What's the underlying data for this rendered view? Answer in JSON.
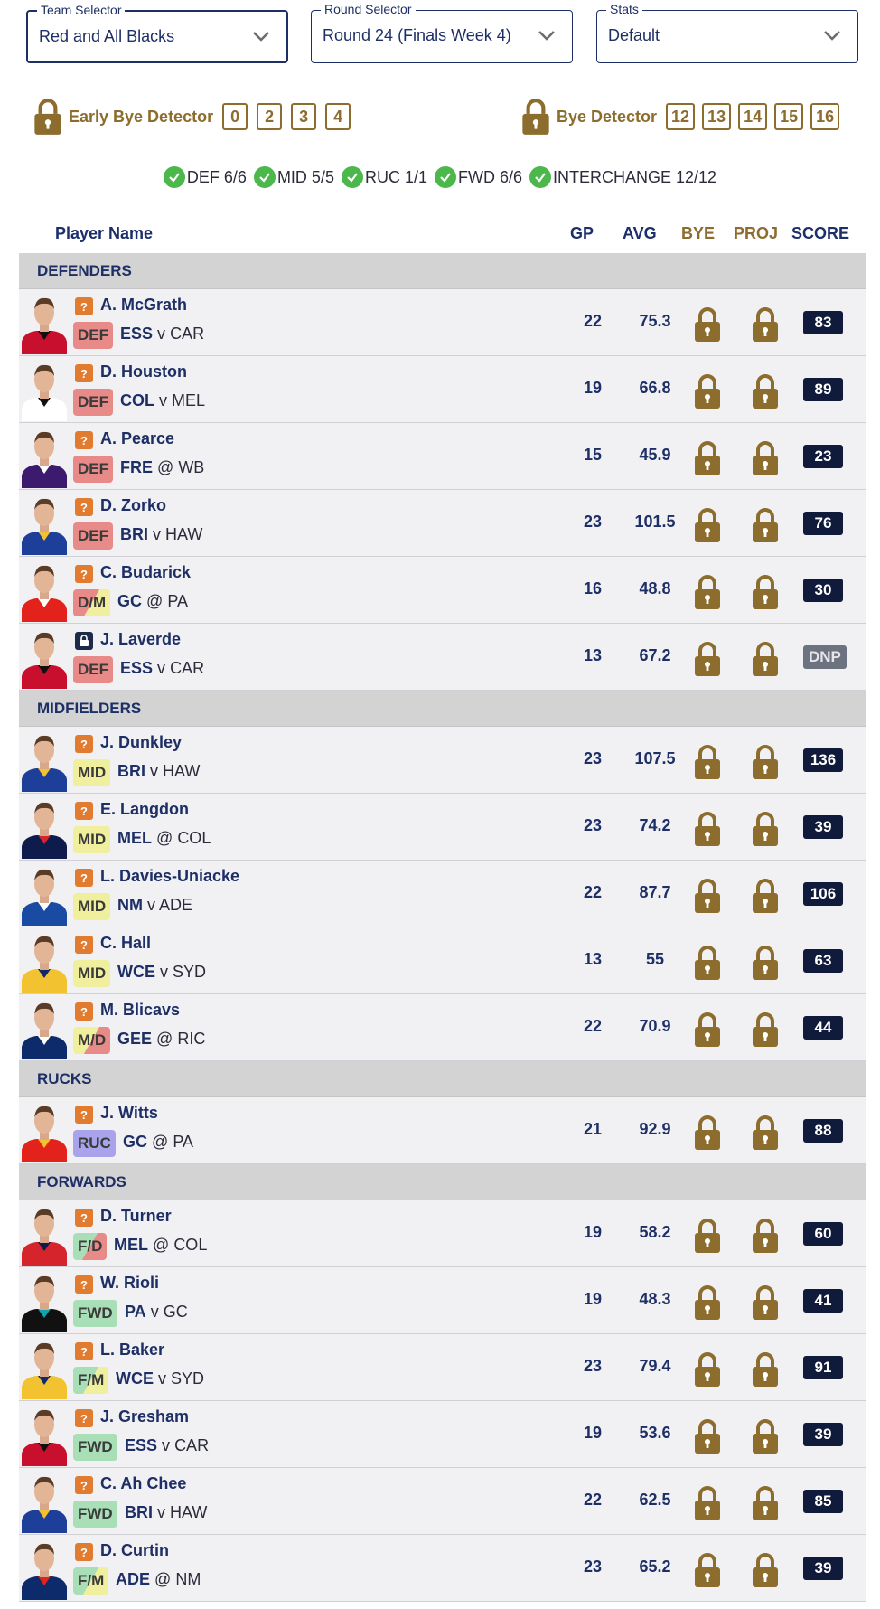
{
  "selectors": {
    "team": {
      "label": "Team Selector",
      "value": "Red and All Blacks"
    },
    "round": {
      "label": "Round Selector",
      "value": "Round 24 (Finals Week 4)"
    },
    "stats": {
      "label": "Stats",
      "value": "Default"
    }
  },
  "early_bye": {
    "label": "Early Bye Detector",
    "boxes": [
      "0",
      "2",
      "3",
      "4"
    ]
  },
  "bye": {
    "label": "Bye Detector",
    "boxes": [
      "12",
      "13",
      "14",
      "15",
      "16"
    ]
  },
  "summary": [
    "DEF 6/6",
    "MID 5/5",
    "RUC 1/1",
    "FWD 6/6",
    "INTERCHANGE 12/12"
  ],
  "table_header": {
    "name": "Player Name",
    "gp": "GP",
    "avg": "AVG",
    "bye": "BYE",
    "proj": "PROJ",
    "score": "SCORE"
  },
  "colors": {
    "navy": "#1e2f66",
    "gold": "#8c6d2e",
    "check": "#4cb74a",
    "score_bg": "#101a3a"
  },
  "sections": [
    {
      "title": "DEFENDERS",
      "players": [
        {
          "name": "A. McGrath",
          "pos": "DEF",
          "team": "ESS",
          "sep": "v",
          "opp": "CAR",
          "gp": "22",
          "avg": "75.3",
          "score": "83",
          "status": "?",
          "jersey": [
            "#c8102e",
            "#101010"
          ]
        },
        {
          "name": "D. Houston",
          "pos": "DEF",
          "team": "COL",
          "sep": "v",
          "opp": "MEL",
          "gp": "19",
          "avg": "66.8",
          "score": "89",
          "status": "?",
          "jersey": [
            "#ffffff",
            "#111111"
          ]
        },
        {
          "name": "A. Pearce",
          "pos": "DEF",
          "team": "FRE",
          "sep": "@",
          "opp": "WB",
          "gp": "15",
          "avg": "45.9",
          "score": "23",
          "status": "?",
          "jersey": [
            "#3c1a6e",
            "#ffffff"
          ]
        },
        {
          "name": "D. Zorko",
          "pos": "DEF",
          "team": "BRI",
          "sep": "v",
          "opp": "HAW",
          "gp": "23",
          "avg": "101.5",
          "score": "76",
          "status": "?",
          "jersey": [
            "#1e3f99",
            "#f2c230"
          ]
        },
        {
          "name": "C. Budarick",
          "pos": "D/M",
          "team": "GC",
          "sep": "@",
          "opp": "PA",
          "gp": "16",
          "avg": "48.8",
          "score": "30",
          "status": "?",
          "jersey": [
            "#e3231b",
            "#ffffff"
          ]
        },
        {
          "name": "J. Laverde",
          "pos": "DEF",
          "team": "ESS",
          "sep": "v",
          "opp": "CAR",
          "gp": "13",
          "avg": "67.2",
          "score": "DNP",
          "status": "lock",
          "jersey": [
            "#c8102e",
            "#101010"
          ]
        }
      ]
    },
    {
      "title": "MIDFIELDERS",
      "players": [
        {
          "name": "J. Dunkley",
          "pos": "MID",
          "team": "BRI",
          "sep": "v",
          "opp": "HAW",
          "gp": "23",
          "avg": "107.5",
          "score": "136",
          "status": "?",
          "jersey": [
            "#1e3f99",
            "#f2c230"
          ]
        },
        {
          "name": "E. Langdon",
          "pos": "MID",
          "team": "MEL",
          "sep": "@",
          "opp": "COL",
          "gp": "23",
          "avg": "74.2",
          "score": "39",
          "status": "?",
          "jersey": [
            "#0e1b4d",
            "#d5242c"
          ]
        },
        {
          "name": "L. Davies-Uniacke",
          "pos": "MID",
          "team": "NM",
          "sep": "v",
          "opp": "ADE",
          "gp": "22",
          "avg": "87.7",
          "score": "106",
          "status": "?",
          "jersey": [
            "#1a4ba3",
            "#ffffff"
          ]
        },
        {
          "name": "C. Hall",
          "pos": "MID",
          "team": "WCE",
          "sep": "v",
          "opp": "SYD",
          "gp": "13",
          "avg": "55",
          "score": "63",
          "status": "?",
          "jersey": [
            "#f2c230",
            "#0d2b6b"
          ]
        },
        {
          "name": "M. Blicavs",
          "pos": "M/D",
          "team": "GEE",
          "sep": "@",
          "opp": "RIC",
          "gp": "22",
          "avg": "70.9",
          "score": "44",
          "status": "?",
          "jersey": [
            "#0d2b6b",
            "#ffffff"
          ]
        }
      ]
    },
    {
      "title": "RUCKS",
      "players": [
        {
          "name": "J. Witts",
          "pos": "RUC",
          "team": "GC",
          "sep": "@",
          "opp": "PA",
          "gp": "21",
          "avg": "92.9",
          "score": "88",
          "status": "?",
          "jersey": [
            "#e3231b",
            "#f2c230"
          ]
        }
      ]
    },
    {
      "title": "FORWARDS",
      "players": [
        {
          "name": "D. Turner",
          "pos": "F/D",
          "team": "MEL",
          "sep": "@",
          "opp": "COL",
          "gp": "19",
          "avg": "58.2",
          "score": "60",
          "status": "?",
          "jersey": [
            "#d5242c",
            "#0e1b4d"
          ]
        },
        {
          "name": "W. Rioli",
          "pos": "FWD",
          "team": "PA",
          "sep": "v",
          "opp": "GC",
          "gp": "19",
          "avg": "48.3",
          "score": "41",
          "status": "?",
          "jersey": [
            "#111111",
            "#0fa3b1"
          ]
        },
        {
          "name": "L. Baker",
          "pos": "F/M",
          "team": "WCE",
          "sep": "v",
          "opp": "SYD",
          "gp": "23",
          "avg": "79.4",
          "score": "91",
          "status": "?",
          "jersey": [
            "#f2c230",
            "#0d2b6b"
          ]
        },
        {
          "name": "J. Gresham",
          "pos": "FWD",
          "team": "ESS",
          "sep": "v",
          "opp": "CAR",
          "gp": "19",
          "avg": "53.6",
          "score": "39",
          "status": "?",
          "jersey": [
            "#c8102e",
            "#101010"
          ]
        },
        {
          "name": "C. Ah Chee",
          "pos": "FWD",
          "team": "BRI",
          "sep": "v",
          "opp": "HAW",
          "gp": "22",
          "avg": "62.5",
          "score": "85",
          "status": "?",
          "jersey": [
            "#1e3f99",
            "#f2c230"
          ]
        },
        {
          "name": "D. Curtin",
          "pos": "F/M",
          "team": "ADE",
          "sep": "@",
          "opp": "NM",
          "gp": "23",
          "avg": "65.2",
          "score": "39",
          "status": "?",
          "jersey": [
            "#0d2b6b",
            "#e3231b"
          ]
        }
      ]
    }
  ]
}
